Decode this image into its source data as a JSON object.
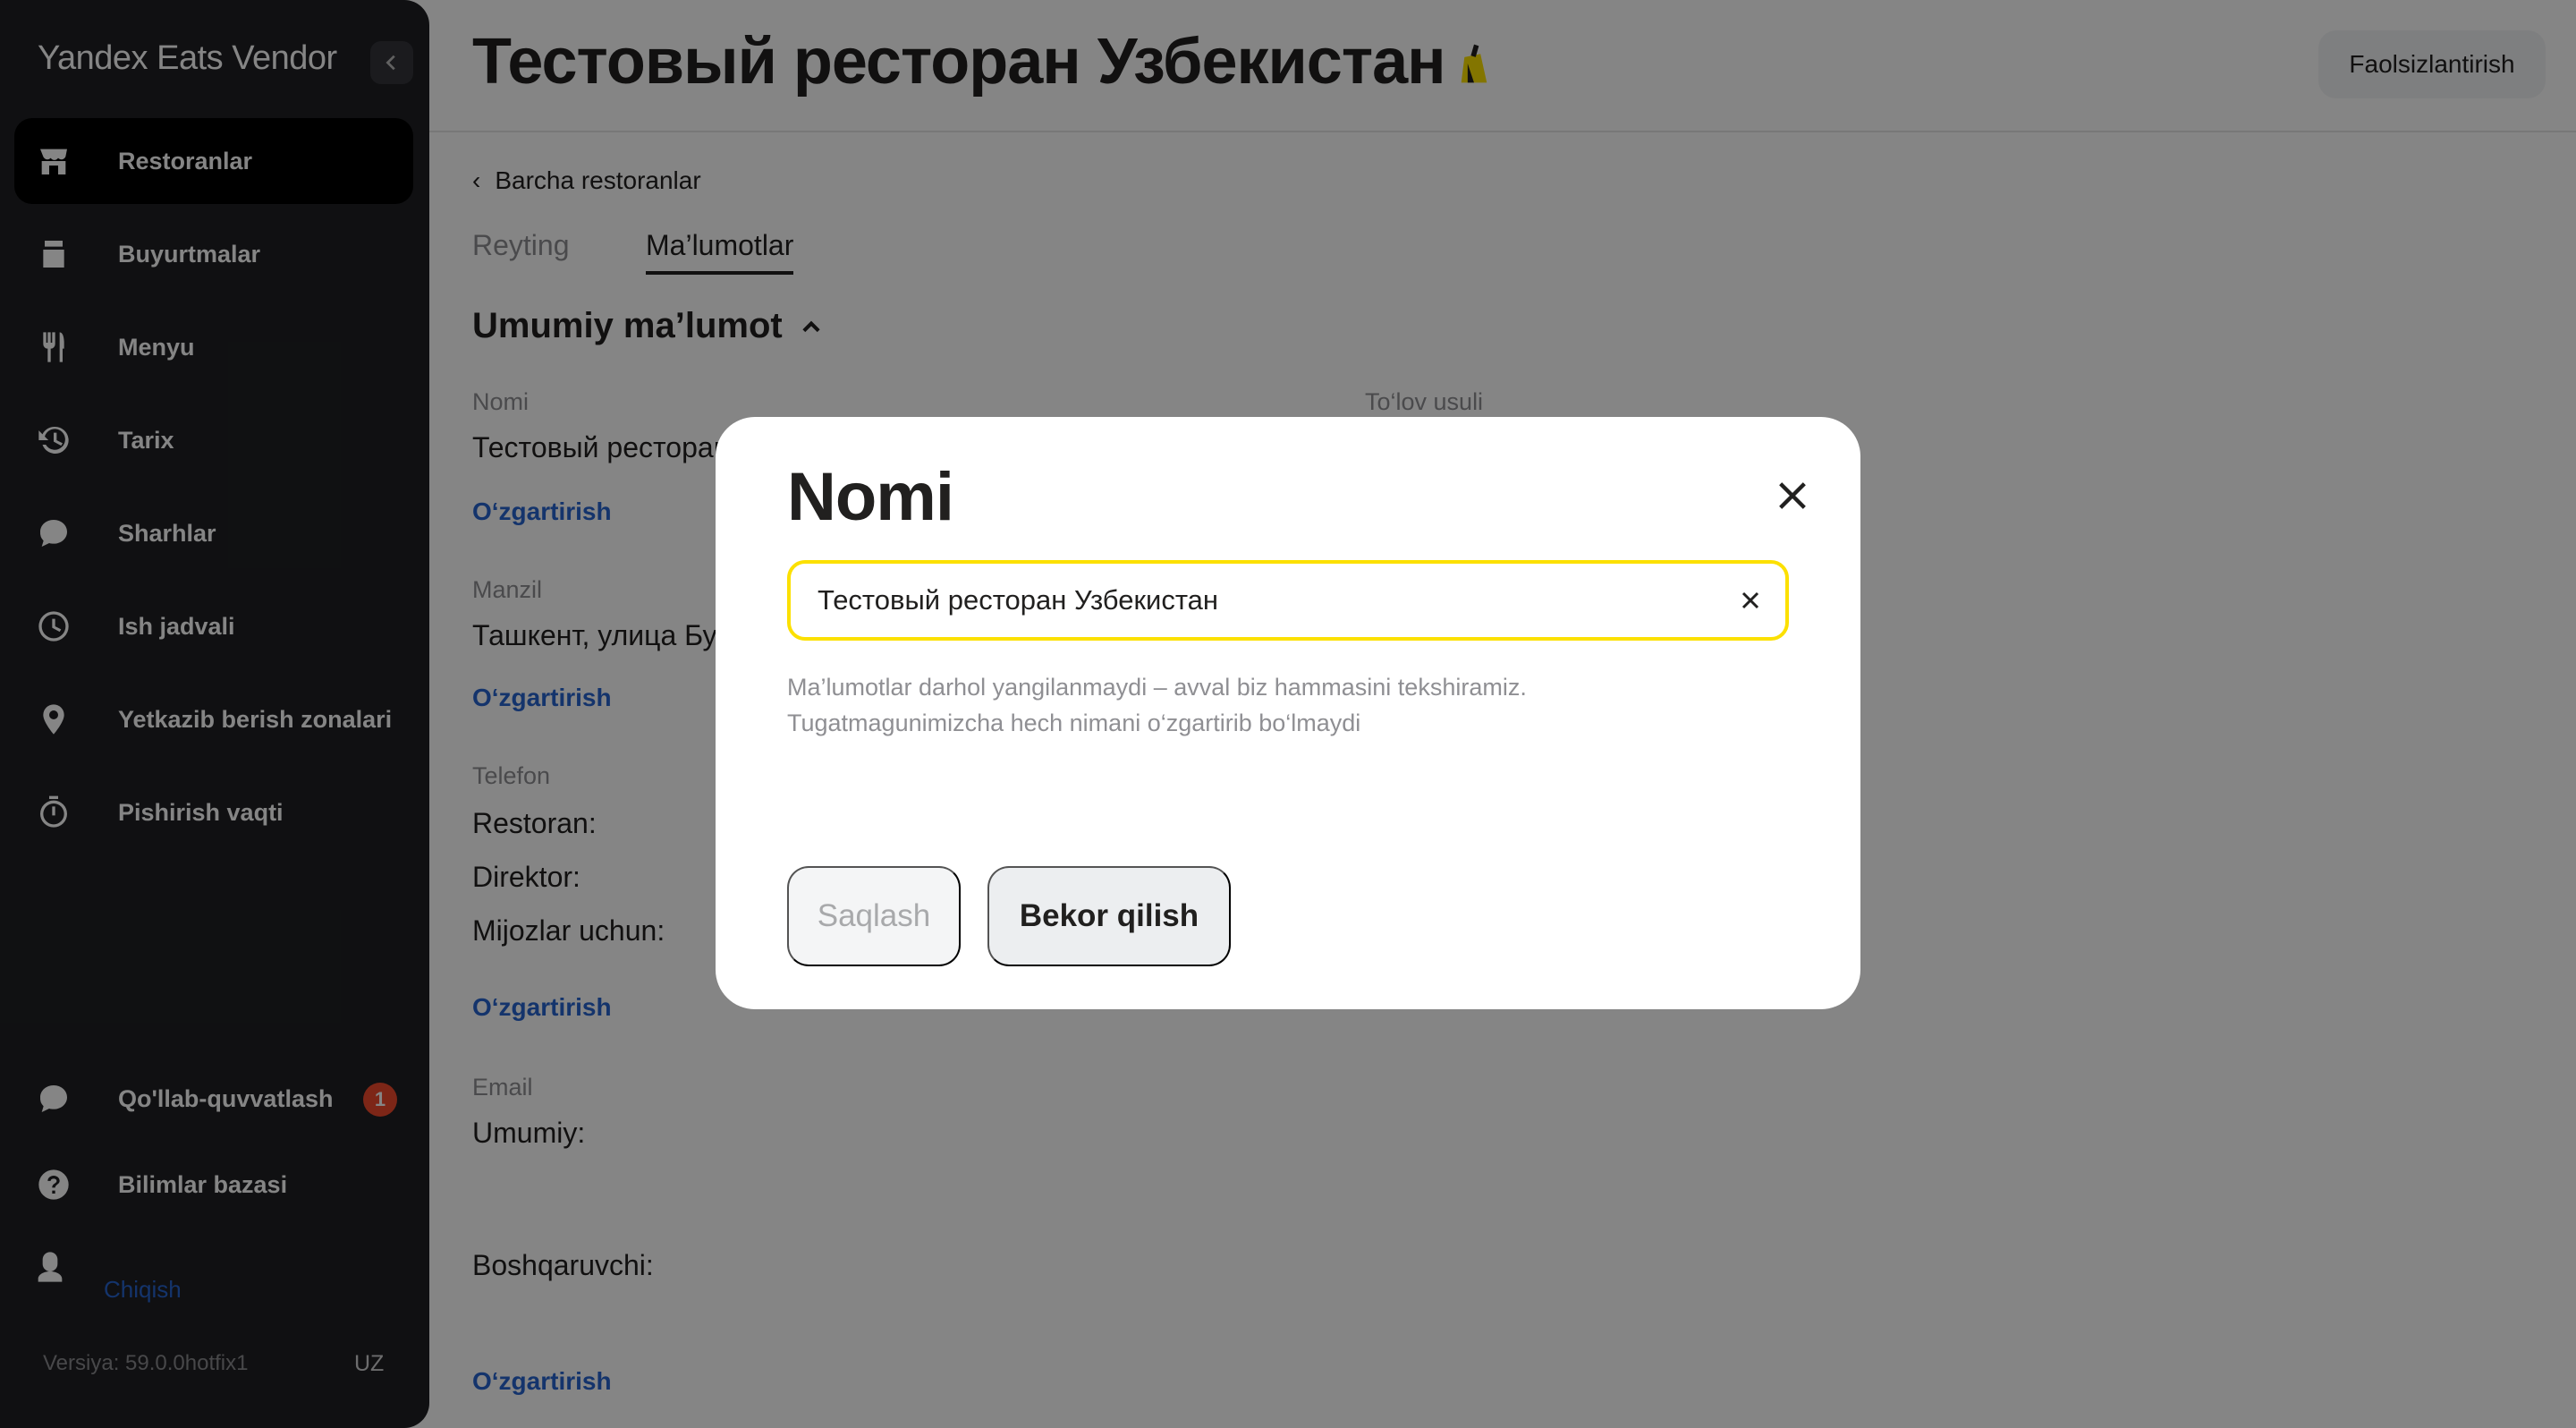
{
  "sidebar": {
    "brand": "Yandex Eats Vendor",
    "items": [
      {
        "label": "Restoranlar"
      },
      {
        "label": "Buyurtmalar"
      },
      {
        "label": "Menyu"
      },
      {
        "label": "Tarix"
      },
      {
        "label": "Sharhlar"
      },
      {
        "label": "Ish jadvali"
      },
      {
        "label": "Yetkazib berish zonalari"
      },
      {
        "label": "Pishirish vaqti"
      }
    ],
    "support": {
      "label": "Qo'llab-quvvatlash",
      "badge": "1"
    },
    "knowledge": {
      "label": "Bilimlar bazasi"
    },
    "logout": "Chiqish",
    "version": "Versiya: 59.0.0hotfix1",
    "lang": "UZ"
  },
  "header": {
    "title": "Тестовый ресторан Узбекистан",
    "deactivate": "Faolsizlantirish"
  },
  "main": {
    "back": "Barcha restoranlar",
    "tabs": [
      {
        "label": "Reyting"
      },
      {
        "label": "Ma’lumotlar"
      }
    ],
    "section_title": "Umumiy ma’lumot",
    "name_label": "Nomi",
    "name_value": "Тестовый ресторан Узбекистан",
    "payment_label": "To‘lov usuli",
    "edit": "O‘zgartirish",
    "address_label": "Manzil",
    "address_value": "Ташкент, улица Бу",
    "phone_label": "Telefon",
    "phone_restaurant": "Restoran:",
    "phone_director": "Direktor:",
    "phone_customers": "Mijozlar uchun:",
    "email_label": "Email",
    "email_general": "Umumiy:",
    "email_manager": "Boshqaruvchi:"
  },
  "modal": {
    "title": "Nomi",
    "input_value": "Тестовый ресторан Узбекистан",
    "hint_line1": "Ma’lumotlar darhol yangilanmaydi – avval biz hammasini tekshiramiz.",
    "hint_line2": "Tugatmagunimizcha hech nimani o‘zgartirib bo‘lmaydi",
    "save": "Saqlash",
    "cancel": "Bekor qilish"
  },
  "colors": {
    "sidebar_bg": "#1f2023",
    "accent_yellow": "#fce000",
    "link_blue": "#2864cf",
    "badge_red": "#f0492c"
  }
}
